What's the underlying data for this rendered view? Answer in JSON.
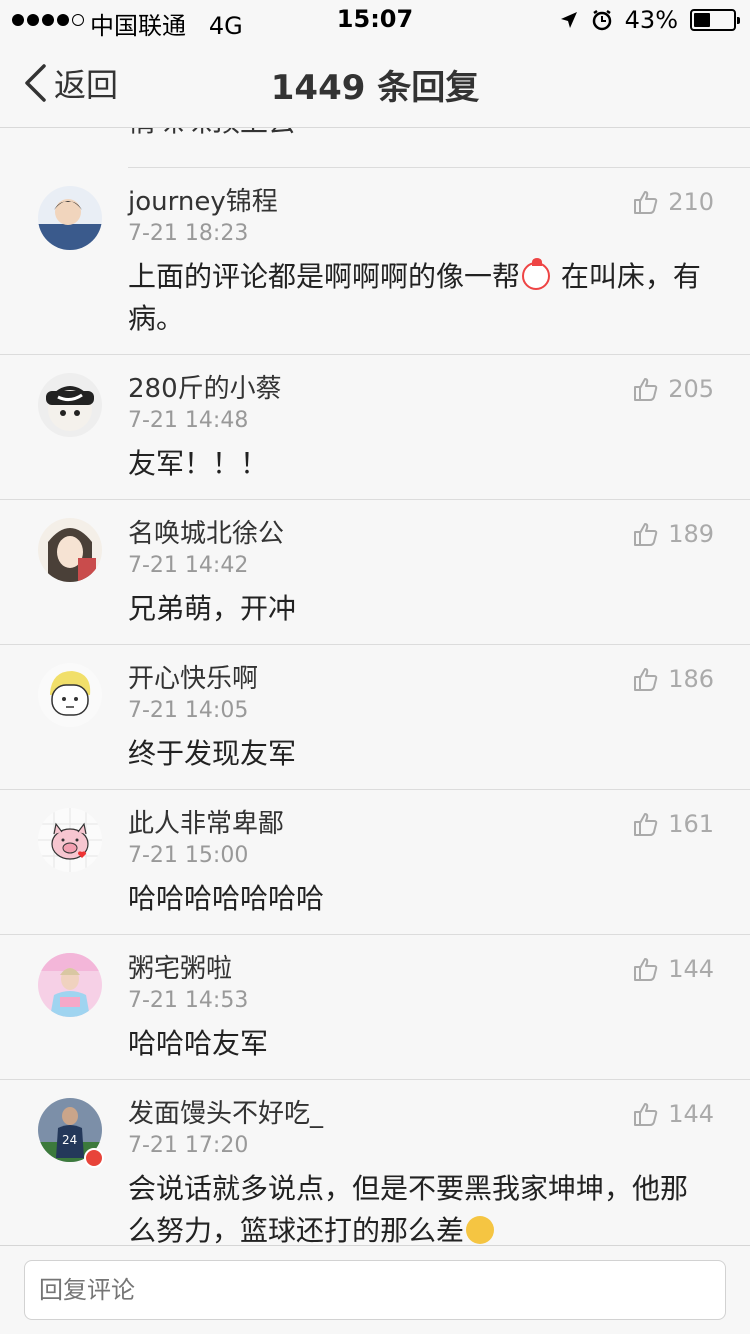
{
  "status_bar": {
    "carrier": "●●●●○ 中国联通   4G",
    "time": "15:07",
    "battery_text": "43%",
    "battery_level": 0.43
  },
  "nav": {
    "back_label": "返回",
    "title": "1449 条回复"
  },
  "prev_comment_tail": "情咪咪顶上去",
  "comments": [
    {
      "name": "journey锦程",
      "time": "7-21 18:23",
      "likes": "210",
      "text_before": "上面的评论都是啊啊啊的像一帮",
      "text_after": "在叫床，有病。",
      "avatar_color": "#3a5a8c"
    },
    {
      "name": "280斤的小蔡",
      "time": "7-21 14:48",
      "likes": "205",
      "text": "友军！！！",
      "avatar_color": "#2b2b2b"
    },
    {
      "name": "名唤城北徐公",
      "time": "7-21 14:42",
      "likes": "189",
      "text": "兄弟萌，开冲",
      "avatar_color": "#c8b8a8"
    },
    {
      "name": "开心快乐啊",
      "time": "7-21 14:05",
      "likes": "186",
      "text": "终于发现友军",
      "avatar_color": "#f0e070"
    },
    {
      "name": "此人非常卑鄙",
      "time": "7-21 15:00",
      "likes": "161",
      "text": "哈哈哈哈哈哈哈",
      "avatar_color": "#f7c6d0"
    },
    {
      "name": "粥宅粥啦",
      "time": "7-21 14:53",
      "likes": "144",
      "text": "哈哈哈友军",
      "avatar_color": "#f3b6d9"
    },
    {
      "name": "发面馒头不好吃_",
      "time": "7-21 17:20",
      "likes": "144",
      "text": "会说话就多说点，但是不要黑我家坤坤，他那么努力，篮球还打的那么差",
      "avatar_color": "#2f4f6f"
    }
  ],
  "reply_bar": {
    "placeholder": "回复评论"
  }
}
